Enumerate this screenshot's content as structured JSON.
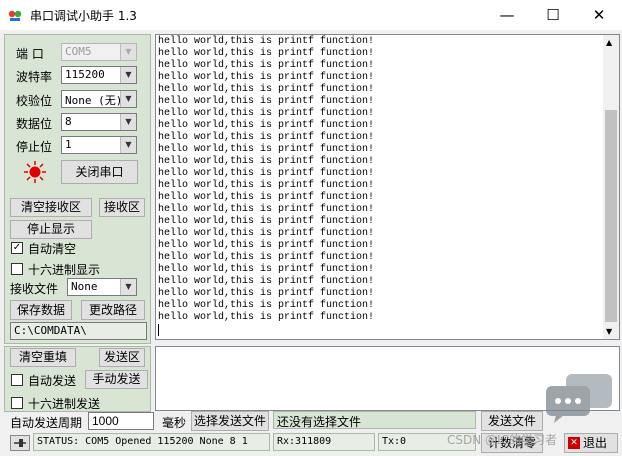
{
  "window": {
    "title": "串口调试小助手 1.3",
    "minimize": "—",
    "maximize": "☐",
    "close": "✕"
  },
  "port_settings": {
    "port_label": "端  口",
    "port_value": "COM5",
    "baud_label": "波特率",
    "baud_value": "115200",
    "parity_label": "校验位",
    "parity_value": "None (无)",
    "data_bits_label": "数据位",
    "data_bits_value": "8",
    "stop_bits_label": "停止位",
    "stop_bits_value": "1",
    "close_port": "关闭串口",
    "indicator_color": "#e00000"
  },
  "receive": {
    "clear": "清空接收区",
    "recv_area": "接收区",
    "stop_display": "停止显示",
    "auto_clear": "自动清空",
    "hex_display": "十六进制显示",
    "recv_file": "接收文件",
    "recv_file_value": "None",
    "save_data": "保存数据",
    "change_path": "更改路径",
    "path": "C:\\COMDATA\\",
    "lines": [
      "hello world,this is printf function!",
      "hello world,this is printf function!",
      "hello world,this is printf function!",
      "hello world,this is printf function!",
      "hello world,this is printf function!",
      "hello world,this is printf function!",
      "hello world,this is printf function!",
      "hello world,this is printf function!",
      "hello world,this is printf function!",
      "hello world,this is printf function!",
      "hello world,this is printf function!",
      "hello world,this is printf function!",
      "hello world,this is printf function!",
      "hello world,this is printf function!",
      "hello world,this is printf function!",
      "hello world,this is printf function!",
      "hello world,this is printf function!",
      "hello world,this is printf function!",
      "hello world,this is printf function!",
      "hello world,this is printf function!",
      "hello world,this is printf function!",
      "hello world,this is printf function!",
      "hello world,this is printf function!",
      "hello world,this is printf function!"
    ]
  },
  "send": {
    "clear_resend": "清空重填",
    "send_area": "发送区",
    "auto_send": "自动发送",
    "manual_send": "手动发送",
    "hex_send": "十六进制发送",
    "period_label": "自动发送周期",
    "period_value": "1000",
    "ms": "毫秒",
    "choose_file": "选择发送文件",
    "no_file": "还没有选择文件",
    "send_file": "发送文件"
  },
  "statusbar": {
    "status": "STATUS: COM5 Opened 115200 None  8 1",
    "rx": "Rx:311809",
    "tx": "Tx:0",
    "clear_count": "计数清零",
    "exit": "退出",
    "watermark": "CSDN @IC的学习者"
  }
}
